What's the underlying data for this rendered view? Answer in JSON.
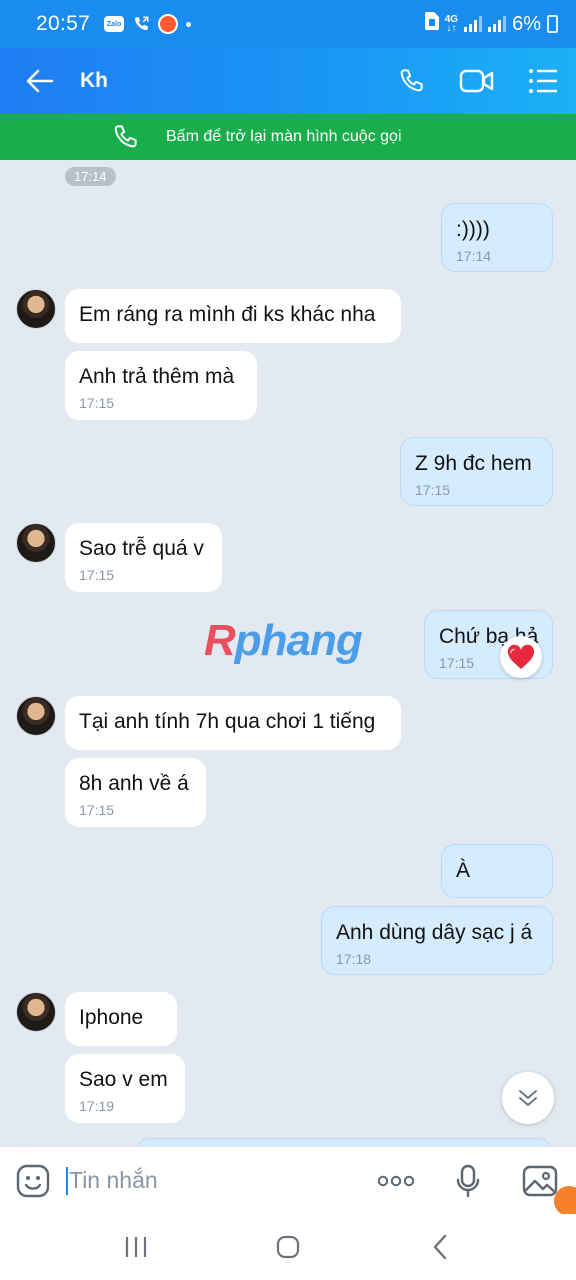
{
  "status_bar": {
    "time": "20:57",
    "app_icons": [
      "zalo-icon",
      "phone-call-icon",
      "screen-recorder-icon",
      "notification-dot-icon"
    ],
    "zalo_chip": "Zalo",
    "network_label": "4G",
    "battery": "6%"
  },
  "header": {
    "title": "Kh",
    "back_icon": "arrow-left-icon",
    "actions": [
      "phone-icon",
      "video-icon",
      "menu-list-icon"
    ]
  },
  "call_banner": {
    "text": "Bấm để trở lại màn hình cuộc gọi",
    "icon": "phone-icon"
  },
  "conversation": {
    "top_time": "17:14",
    "messages": [
      {
        "side": "out",
        "text": ":))))",
        "time": "17:14"
      },
      {
        "side": "in",
        "text": "Em ráng ra mình đi ks khác nha",
        "time": ""
      },
      {
        "side": "in",
        "text": "Anh trả thêm mà",
        "time": "17:15"
      },
      {
        "side": "out",
        "text": "Z 9h đc hem",
        "time": "17:15"
      },
      {
        "side": "in",
        "text": "Sao trễ quá v",
        "time": "17:15"
      },
      {
        "side": "out",
        "text": "Chứ bạ hả",
        "time": "17:15",
        "reaction": "heart-icon"
      },
      {
        "side": "in",
        "text": "Tại anh tính 7h qua chơi 1 tiếng",
        "time": ""
      },
      {
        "side": "in",
        "text": "8h anh về á",
        "time": "17:15"
      },
      {
        "side": "out",
        "text": "À",
        "time": ""
      },
      {
        "side": "out",
        "text": "Anh dùng dây sạc j á",
        "time": "17:18"
      },
      {
        "side": "in",
        "text": "Iphone",
        "time": ""
      },
      {
        "side": "in",
        "text": "Sao v em",
        "time": "17:19"
      }
    ],
    "watermark": {
      "first": "R",
      "rest": "phang"
    }
  },
  "input_bar": {
    "placeholder": "Tin nhắn",
    "icons": [
      "emoji-icon",
      "more-options-icon",
      "microphone-icon",
      "image-icon"
    ]
  },
  "nav_bar": {
    "icons": [
      "recent-apps-icon",
      "home-icon",
      "back-icon"
    ]
  },
  "colors": {
    "header_gradient_start": "#1f7df3",
    "header_gradient_end": "#1cb0f6",
    "call_banner": "#1aad4c",
    "chat_background": "#e2e9f1",
    "outgoing_bubble": "#d5ecff",
    "incoming_bubble": "#ffffff",
    "heart": "#e8283c"
  }
}
